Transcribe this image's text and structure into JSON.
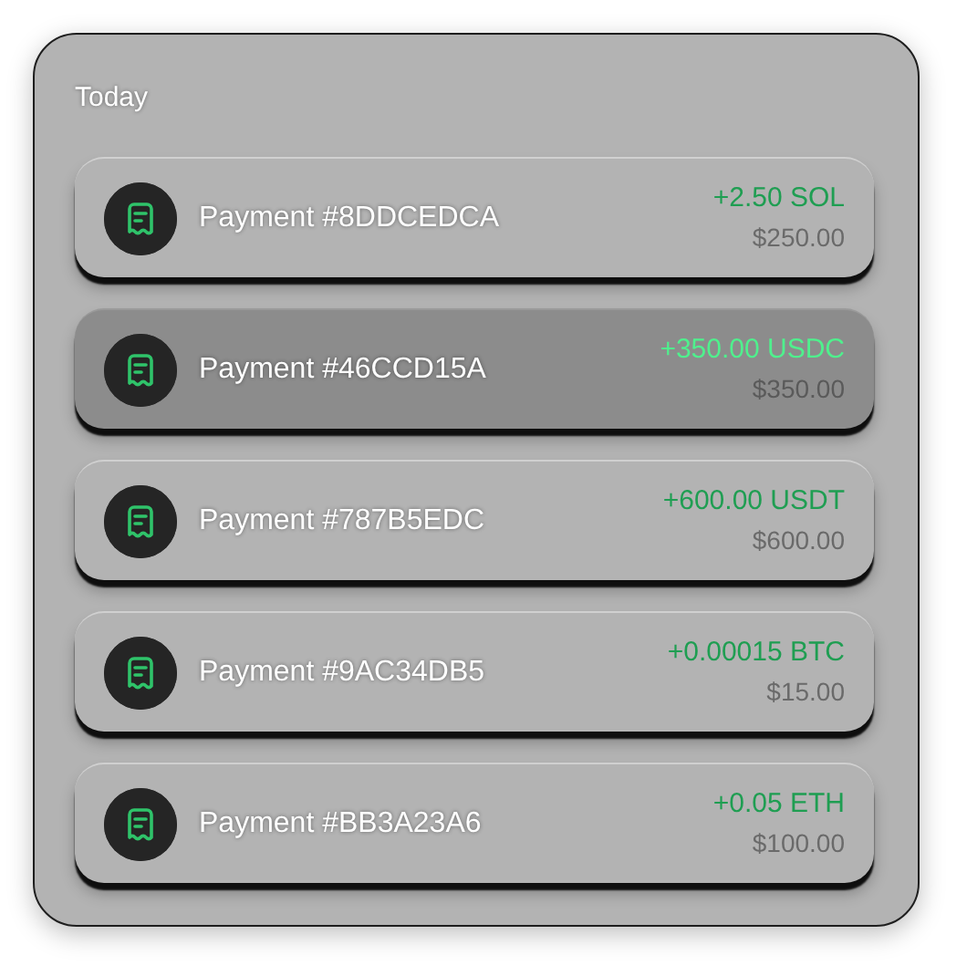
{
  "section_title": "Today",
  "payments": [
    {
      "title": "Payment #8DDCEDCA",
      "amount": "+2.50 SOL",
      "fiat": "$250.00",
      "selected": false
    },
    {
      "title": "Payment #46CCD15A",
      "amount": "+350.00 USDC",
      "fiat": "$350.00",
      "selected": true
    },
    {
      "title": "Payment #787B5EDC",
      "amount": "+600.00 USDT",
      "fiat": "$600.00",
      "selected": false
    },
    {
      "title": "Payment #9AC34DB5",
      "amount": "+0.00015 BTC",
      "fiat": "$15.00",
      "selected": false
    },
    {
      "title": "Payment #BB3A23A6",
      "amount": "+0.05 ETH",
      "fiat": "$100.00",
      "selected": false
    }
  ]
}
